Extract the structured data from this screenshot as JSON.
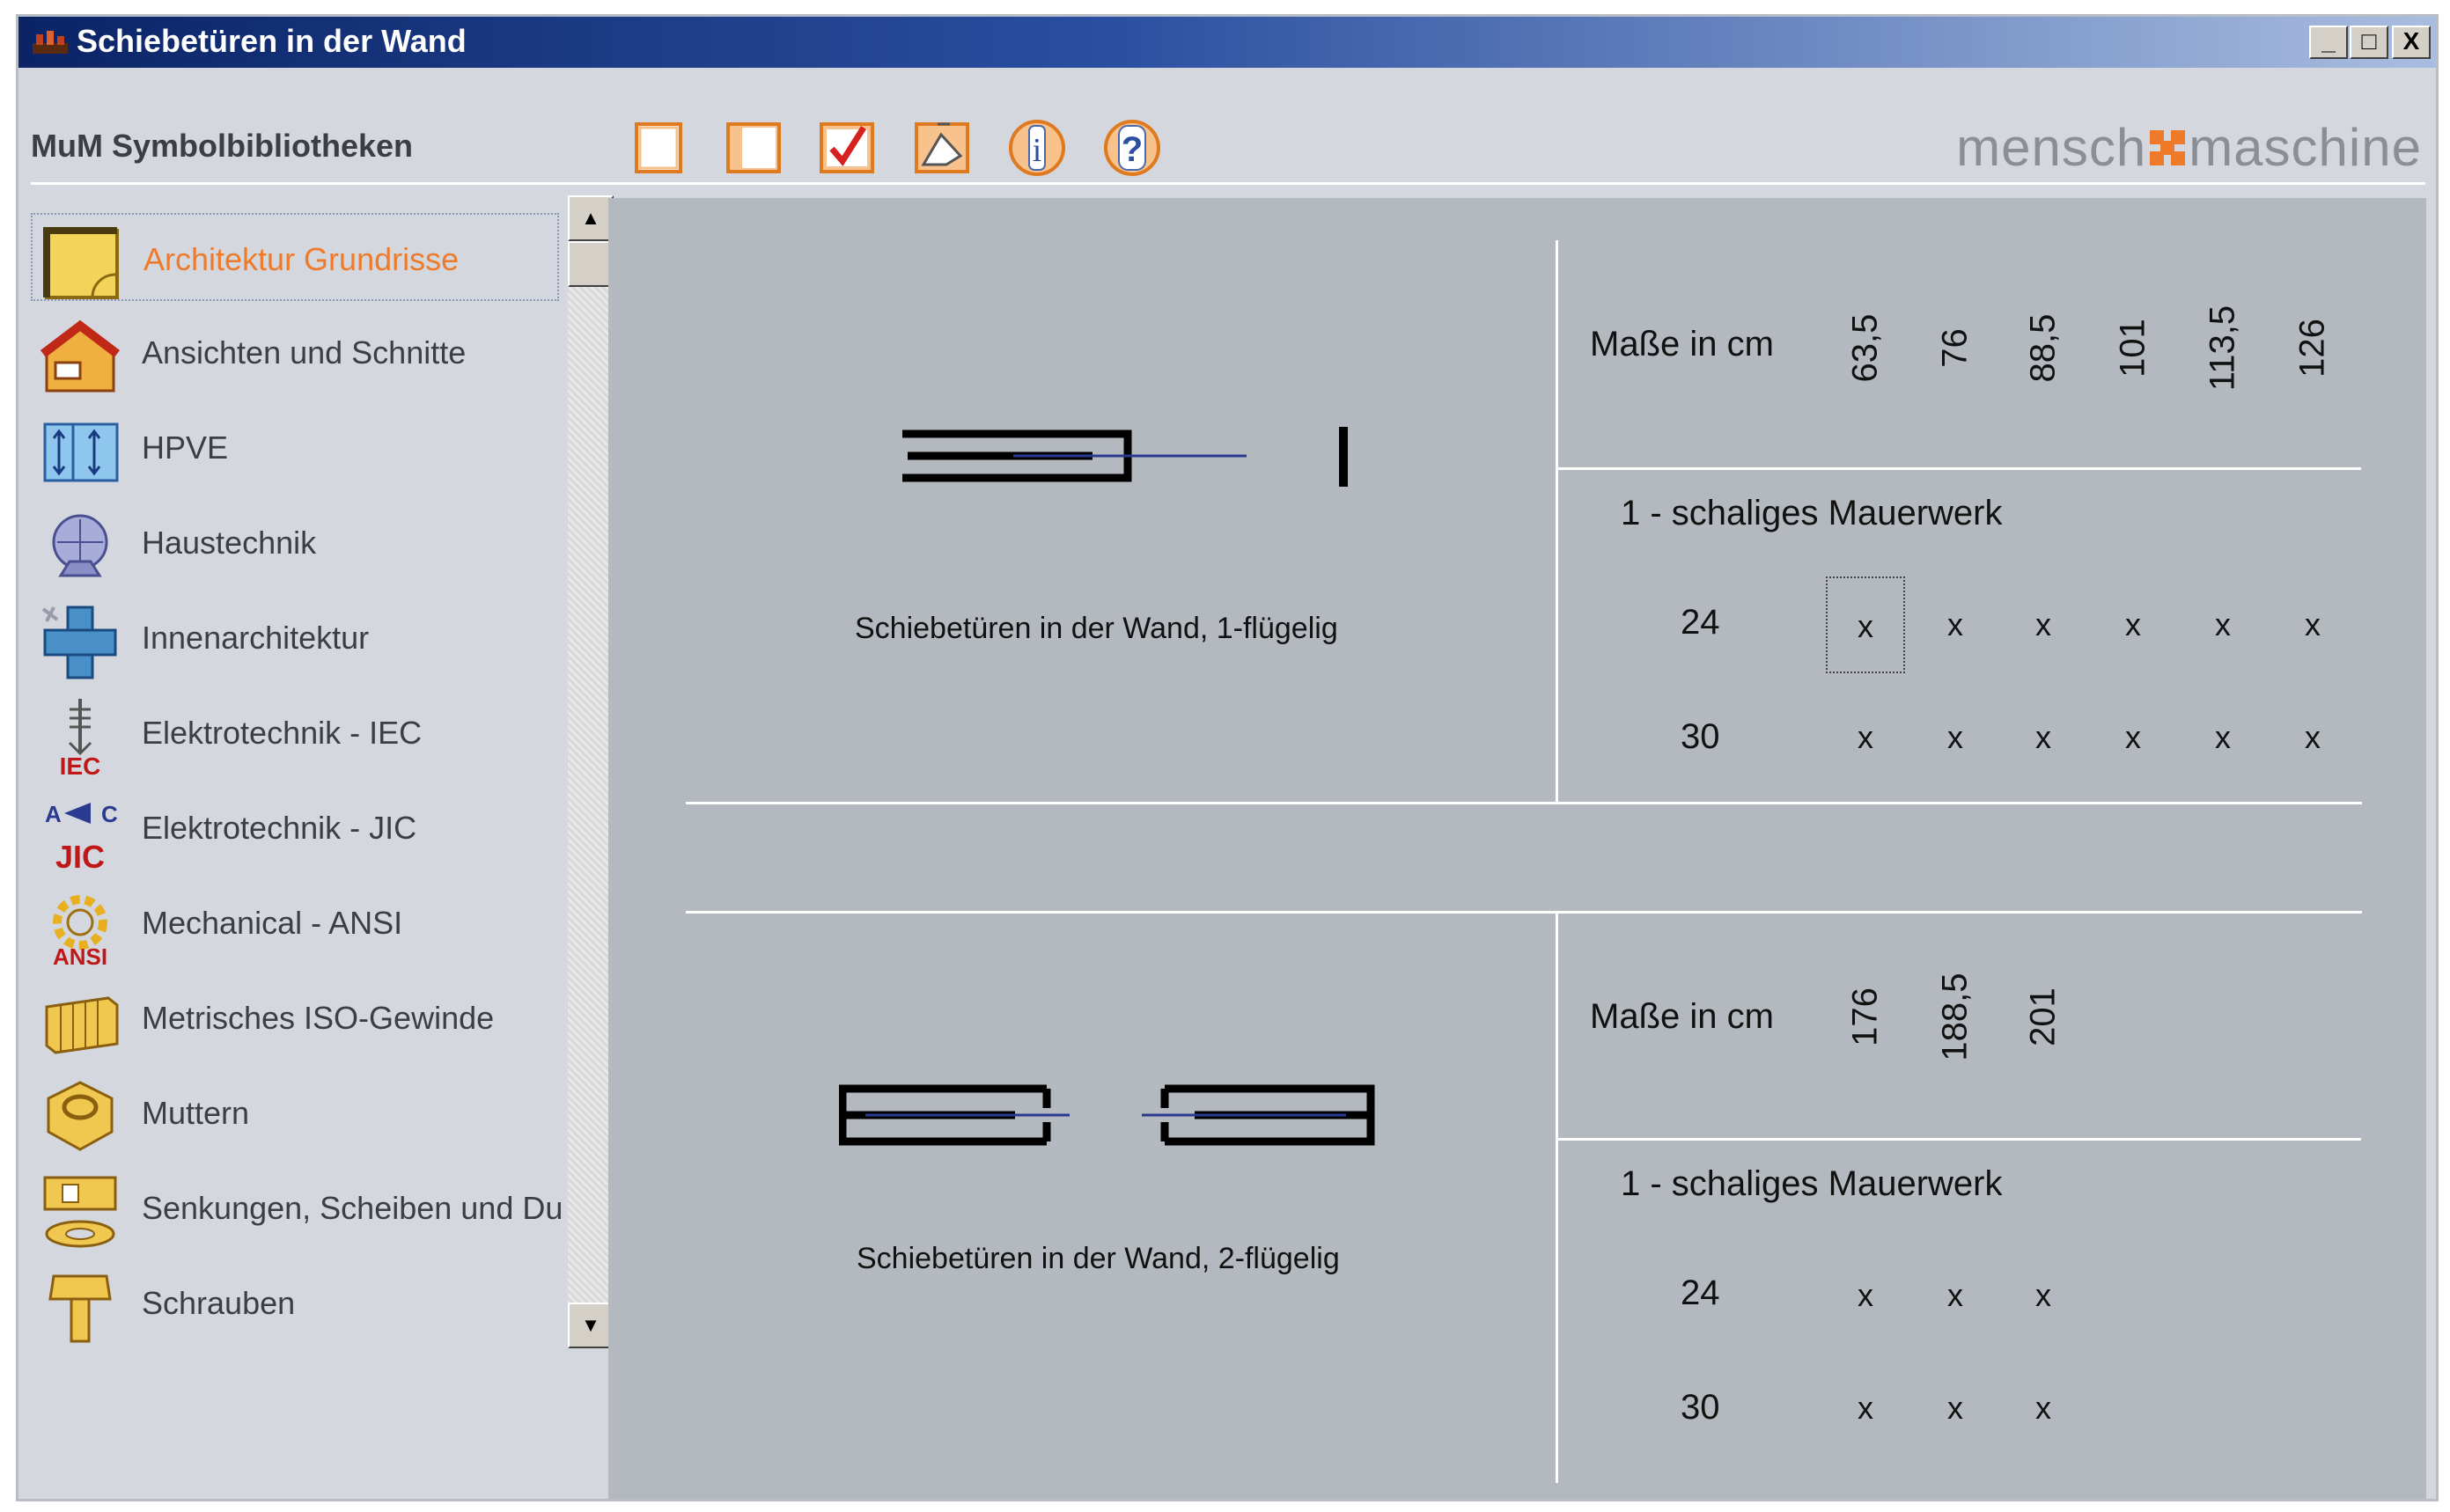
{
  "window": {
    "title": "Schiebetüren in der Wand",
    "controls": {
      "minimize": "_",
      "maximize": "□",
      "close": "X"
    }
  },
  "toolbar": {
    "library_label": "MuM Symbolbibliotheken",
    "buttons": [
      "blank-doc-icon",
      "panel-icon",
      "checkmark-icon",
      "draw-icon",
      "info-icon",
      "help-icon"
    ],
    "info_glyph": "i",
    "help_glyph": "?",
    "logo_left": "mensch",
    "logo_right": "maschine",
    "logo_accent_color": "#ef7a2a"
  },
  "sidebar": {
    "items": [
      {
        "label": "Architektur Grundrisse",
        "icon": "floorplan-icon",
        "selected": true
      },
      {
        "label": "Ansichten und Schnitte",
        "icon": "house-icon"
      },
      {
        "label": "HPVE",
        "icon": "hpve-icon"
      },
      {
        "label": "Haustechnik",
        "icon": "hvac-icon"
      },
      {
        "label": "Innenarchitektur",
        "icon": "interior-icon"
      },
      {
        "label": "Elektrotechnik - IEC",
        "icon": "iec-icon",
        "badge": "IEC"
      },
      {
        "label": "Elektrotechnik - JIC",
        "icon": "jic-icon",
        "badge": "JIC"
      },
      {
        "label": "Mechanical - ANSI",
        "icon": "ansi-gear-icon",
        "badge": "ANSI"
      },
      {
        "label": "Metrisches ISO-Gewinde",
        "icon": "thread-icon"
      },
      {
        "label": "Muttern",
        "icon": "nut-icon"
      },
      {
        "label": "Senkungen, Scheiben und Du",
        "icon": "washer-icon"
      },
      {
        "label": "Schrauben",
        "icon": "screw-icon"
      }
    ],
    "scroll_up": "▲",
    "scroll_down": "▼"
  },
  "sections": [
    {
      "caption": "Schiebetüren in der Wand, 1-flügelig",
      "masse_label": "Maße in cm",
      "columns": [
        "63,5",
        "76",
        "88,5",
        "101",
        "113,5",
        "126"
      ],
      "wall_label": "1 - schaliges Mauerwerk",
      "rows": [
        {
          "thickness": "24",
          "cells": [
            "x",
            "x",
            "x",
            "x",
            "x",
            "x"
          ]
        },
        {
          "thickness": "30",
          "cells": [
            "x",
            "x",
            "x",
            "x",
            "x",
            "x"
          ]
        }
      ]
    },
    {
      "caption": "Schiebetüren in der Wand, 2-flügelig",
      "masse_label": "Maße in cm",
      "columns": [
        "176",
        "188,5",
        "201"
      ],
      "wall_label": "1 - schaliges Mauerwerk",
      "rows": [
        {
          "thickness": "24",
          "cells": [
            "x",
            "x",
            "x"
          ]
        },
        {
          "thickness": "30",
          "cells": [
            "x",
            "x",
            "x"
          ]
        }
      ]
    }
  ],
  "colors": {
    "titlebar_dark": "#0b2466",
    "selected_text": "#ef7a2a",
    "panel_bg": "#b4b9bf",
    "window_bg": "#d4d8de"
  }
}
